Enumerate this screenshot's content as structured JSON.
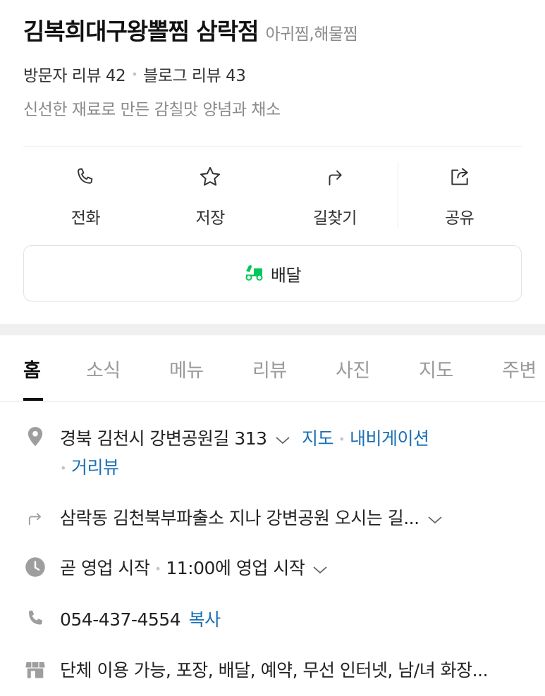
{
  "place": {
    "name": "김복희대구왕뽈찜 삼락점",
    "category": "아귀찜,해물찜",
    "visitor_reviews": "방문자 리뷰 42",
    "blog_reviews": "블로그 리뷰 43",
    "tagline": "신선한 재료로 만든 감칠맛 양념과 채소"
  },
  "actions": [
    {
      "label": "전화",
      "icon": "phone-icon"
    },
    {
      "label": "저장",
      "icon": "star-icon"
    },
    {
      "label": "길찾기",
      "icon": "directions-icon"
    },
    {
      "label": "공유",
      "icon": "share-icon"
    }
  ],
  "delivery": {
    "label": "배달",
    "icon": "delivery-scooter-icon",
    "icon_color": "#03c75a"
  },
  "tabs": [
    {
      "label": "홈",
      "active": true
    },
    {
      "label": "소식"
    },
    {
      "label": "메뉴"
    },
    {
      "label": "리뷰"
    },
    {
      "label": "사진"
    },
    {
      "label": "지도"
    },
    {
      "label": "주변"
    }
  ],
  "info": {
    "address": "경북 김천시 강변공원길 313",
    "address_links": [
      "지도",
      "내비게이션",
      "거리뷰"
    ],
    "directions": "삼락동 김천북부파출소 지나 강변공원 오시는 길...",
    "hours_status": "곧 영업 시작",
    "hours_detail": "11:00에 영업 시작",
    "phone": "054-437-4554",
    "copy_label": "복사",
    "amenities": "단체 이용 가능, 포장, 배달, 예약, 무선 인터넷, 남/녀 화장..."
  },
  "colors": {
    "link": "#1a6fb5",
    "accent_green": "#03c75a",
    "icon_gray": "#9e9e9e"
  }
}
